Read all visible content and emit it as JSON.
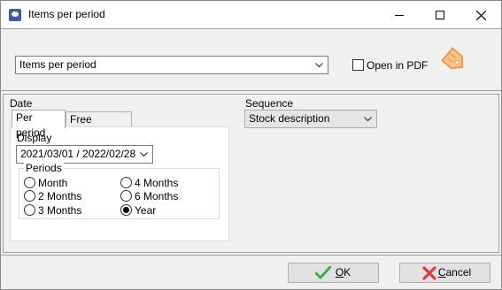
{
  "window": {
    "title": "Items per period",
    "icon": "app-icon",
    "controls": [
      "minimize-icon",
      "maximize-icon",
      "close-icon"
    ]
  },
  "report_select": {
    "value": "Items per period"
  },
  "open_in_pdf": {
    "label": "Open in PDF",
    "checked": false
  },
  "date_section": {
    "label": "Date",
    "tabs": [
      {
        "label": "Per period",
        "active": true
      },
      {
        "label": "Free selection",
        "active": false
      }
    ],
    "display": {
      "label": "Display",
      "value": "2021/03/01 / 2022/02/28"
    },
    "periods": {
      "label": "Periods",
      "options": [
        {
          "label": "Month",
          "checked": false
        },
        {
          "label": "2 Months",
          "checked": false
        },
        {
          "label": "3 Months",
          "checked": false
        },
        {
          "label": "4 Months",
          "checked": false
        },
        {
          "label": "6 Months",
          "checked": false
        },
        {
          "label": "Year",
          "checked": true
        }
      ]
    }
  },
  "sequence": {
    "label": "Sequence",
    "value": "Stock description"
  },
  "buttons": {
    "ok": {
      "label_mnemonic": "O",
      "label_rest": "K"
    },
    "cancel": {
      "label_mnemonic": "C",
      "label_rest": "ancel"
    }
  },
  "colors": {
    "ok_check": "#3cb043",
    "cancel_x": "#e03a3a",
    "tag_icon": "#f29a4b"
  }
}
